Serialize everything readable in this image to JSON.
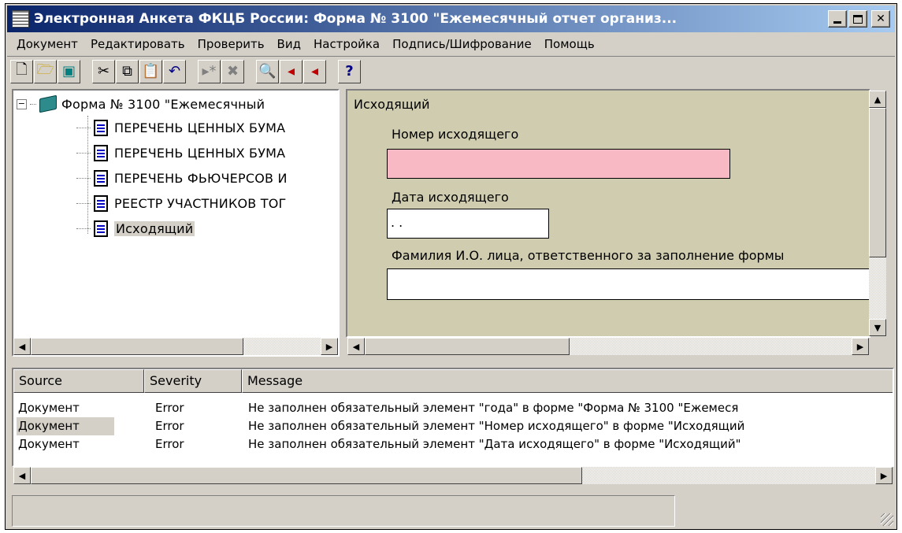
{
  "window": {
    "title": "Электронная Анкета ФКЦБ России: Форма № 3100 \"Ежемесячный отчет организ..."
  },
  "menu": [
    "Документ",
    "Редактировать",
    "Проверить",
    "Вид",
    "Настройка",
    "Подпись/Шифрование",
    "Помощь"
  ],
  "toolbar": {
    "icons": [
      "new-icon",
      "open-icon",
      "save-icon",
      "cut-icon",
      "copy-icon",
      "paste-icon",
      "undo-icon",
      "insert-disabled-icon",
      "delete-disabled-icon",
      "preview-icon",
      "check-next-icon",
      "check-prev-icon",
      "help-icon"
    ]
  },
  "tree": {
    "root": "Форма № 3100 \"Ежемесячный",
    "items": [
      "ПЕРЕЧЕНЬ ЦЕННЫХ БУМА",
      "ПЕРЕЧЕНЬ ЦЕННЫХ БУМА",
      "ПЕРЕЧЕНЬ ФЬЮЧЕРСОВ И",
      "РЕЕСТР УЧАСТНИКОВ ТОГ",
      "Исходящий"
    ],
    "selected_index": 4
  },
  "form": {
    "section_title": "Исходящий",
    "outgoing_number_label": "Номер исходящего",
    "outgoing_number_value": "",
    "outgoing_date_label": "Дата исходящего",
    "outgoing_date_value": ". .",
    "responsible_label": "Фамилия И.О. лица, ответственного за заполнение формы",
    "responsible_value": "",
    "required_color": "#f8b8c4"
  },
  "messages": {
    "columns": [
      "Source",
      "Severity",
      "Message"
    ],
    "rows": [
      {
        "source": "Документ",
        "severity": "Error",
        "message": "Не заполнен обязательный элемент \"года\" в форме \"Форма № 3100 \"Ежемеся"
      },
      {
        "source": "Документ",
        "severity": "Error",
        "message": "Не заполнен обязательный элемент \"Номер исходящего\" в форме \"Исходящий"
      },
      {
        "source": "Документ",
        "severity": "Error",
        "message": "Не заполнен обязательный элемент \"Дата исходящего\" в форме \"Исходящий\""
      }
    ],
    "selected_index": 1
  },
  "status": {
    "text": ""
  }
}
